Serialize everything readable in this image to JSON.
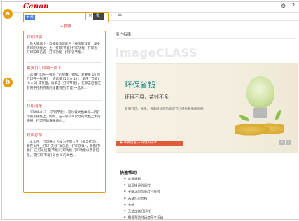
{
  "app": {
    "logo": "Canon"
  },
  "topbar": {
    "icons": [
      "gear-icon",
      "question-icon"
    ]
  },
  "search": {
    "value": "节能",
    "clear_icon": "×",
    "button_icon": "search-icon",
    "more_label": "+ 搜索"
  },
  "results": [
    {
      "title": "打印旧稿",
      "snippet": "…放大或缩小 · 自换来源可能合 · 换页面双面 · 单多页印刷功能之一上 · 打印[节能] 打印功能 · 打印省 · 打印旧稿已省 · 打印功能 · 打印省节能..."
    },
    {
      "title": "将多页打印到一页上",
      "snippet": "…选择打印在一张纸上的页数，例如，若要将 16 页打印在一张纸上，请选择 [16 合 1] 。 单击 [节能] [8 x 2] 或页面，请单击 [打印节能] ，在单击后面还有用于控制方向的设置可在[节能]中选择..."
    },
    {
      "title": "打印海报",
      "snippet": "…12WA-012 · 打印[节能] · 可以将文档中的一页打印到多张纸上，例如，在一张 A4 尺寸的文档上大的海报，打印后的海报缩小..."
    },
    {
      "title": "双面打印",
      "snippet": "…此文件 · 打印通过 PIN 为不同文件（保全打印），要在文件上打印“无效”演示后（打印次数），单击[节能]，还可以设置[节能]打印功能 打印功能以节省纸张，或打印[节能] 2 合 1 的文档..."
    }
  ],
  "badges": {
    "a": "a",
    "b": "b"
  },
  "main": {
    "nav_icons": [
      "home-icon",
      "menu-icon"
    ],
    "breadcrumb": "用户指南",
    "product_name": "imageCLASS",
    "banner": {
      "title": "环保省钱",
      "subtitle": "环境不易，花钱不多",
      "desc": "双面打印、省墨、省电模式等功能可节约纸张和墨粉消耗。",
      "bar": "▶ 环保设置 → 环境和成本...",
      "nav": [
        "‹",
        "›"
      ]
    },
    "quick": {
      "title": "快速帮助",
      "items": [
        "普通问题",
        "出现错误消息时",
        "卡纸上的指示灯闪烁时",
        "无法打印文档",
        "卡纸",
        "无法正确打印时",
        "需要帮助时请使用本系统"
      ]
    }
  },
  "colors": {
    "accent": "#e6a100",
    "link": "#cc3333",
    "teal": "#1e8a82"
  }
}
